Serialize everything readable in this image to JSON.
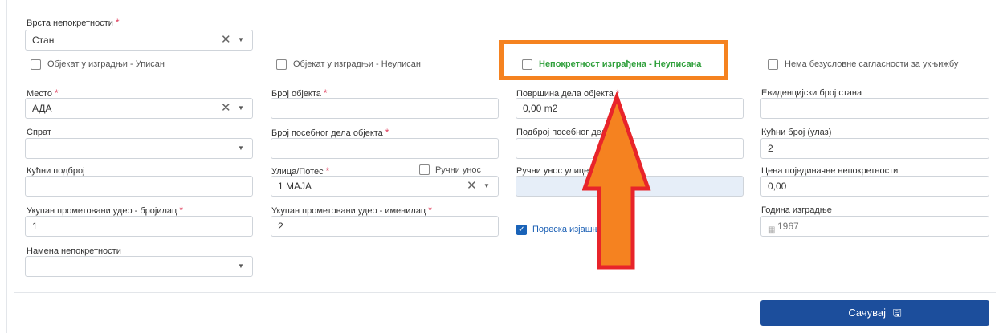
{
  "form": {
    "property_type": {
      "label": "Врста непокретности",
      "required_mark": "*",
      "value": "Стан",
      "clear": "✕",
      "caret": "▼"
    },
    "checkboxes": [
      {
        "label": "Објекат у изградњи - Уписан",
        "checked": false
      },
      {
        "label": "Објекат у изградњи - Неуписан",
        "checked": false
      },
      {
        "label": "Непокретност изграђена - Неуписана",
        "checked": false
      },
      {
        "label": "Нема безусловне сагласности за укњижбу",
        "checked": false
      }
    ],
    "place": {
      "label": "Место",
      "required_mark": "*",
      "value": "АДА",
      "clear": "✕",
      "caret": "▼"
    },
    "object_number": {
      "label": "Број објекта",
      "required_mark": "*",
      "value": ""
    },
    "part_area": {
      "label": "Површина дела објекта",
      "required_mark": "*",
      "value": "0,00 m2"
    },
    "apartment_reg_number": {
      "label": "Евиденцијски број стана",
      "value": ""
    },
    "floor": {
      "label": "Спрат",
      "value": "",
      "caret": "▼"
    },
    "separate_part_number": {
      "label": "Број посебног дела објекта",
      "required_mark": "*",
      "value": ""
    },
    "separate_part_subnumber": {
      "label": "Подброј посебног дела о",
      "value": ""
    },
    "house_number": {
      "label": "Кућни број (улаз)",
      "value": "2"
    },
    "house_subnumber": {
      "label": "Кућни подброј",
      "value": ""
    },
    "street": {
      "label": "Улица/Потес",
      "required_mark": "*",
      "value": "1 МАЈА",
      "clear": "✕",
      "caret": "▼"
    },
    "manual_entry": {
      "label": "Ручни унос",
      "checked": false
    },
    "manual_street": {
      "label": "Ручни унос улице/пот",
      "value": ""
    },
    "unit_price": {
      "label": "Цена појединачне непокретности",
      "value": "0,00"
    },
    "share_numerator": {
      "label": "Укупан прометовани удео - бројилац",
      "required_mark": "*",
      "value": "1"
    },
    "share_denominator": {
      "label": "Укупан прометовани удео - именилац",
      "required_mark": "*",
      "value": "2"
    },
    "tax_statement": {
      "label": "Пореска изјашње",
      "checked": true,
      "check_glyph": "✓"
    },
    "year_built": {
      "label": "Година изградње",
      "value": "1967",
      "icon": "▦"
    },
    "purpose": {
      "label": "Намена непокретности",
      "value": "",
      "caret": "▼"
    },
    "save_button": {
      "label": "Сачувај",
      "icon": "🖫"
    }
  },
  "annotation": {
    "highlight_color": "#f58220",
    "arrow_fill": "#f58220",
    "arrow_stroke": "#e8242a"
  }
}
